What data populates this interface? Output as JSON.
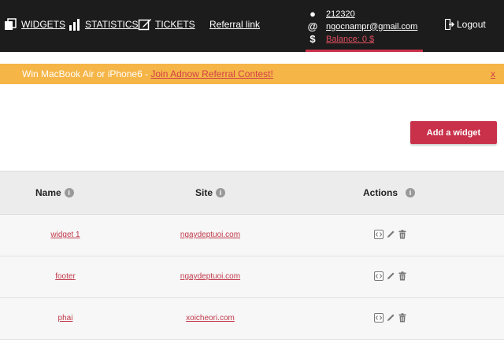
{
  "nav": {
    "widgets_label": "WIDGETS",
    "statistics_label": "STATISTICS",
    "tickets_label": "TICKETS",
    "referral_label": "Referral link"
  },
  "user": {
    "id": "212320",
    "email": "ngocnampr@gmail.com",
    "balance": "Balance: 0 $",
    "logout_label": "Logout"
  },
  "banner": {
    "text": "Win MacBook Air or iPhone6 - ",
    "link": "Join Adnow Referral Contest!",
    "close": "x"
  },
  "add_button_label": "Add a widget",
  "table": {
    "headers": {
      "name": "Name",
      "site": "Site",
      "actions": "Actions"
    },
    "rows": [
      {
        "name": "widget 1",
        "site": "ngaydeptuoi.com"
      },
      {
        "name": "footer",
        "site": "ngaydeptuoi.com"
      },
      {
        "name": "phai",
        "site": "xoicheori.com"
      }
    ]
  },
  "icons": {
    "widgets": "widgets-icon",
    "statistics": "bar-chart-icon",
    "tickets": "edit-icon",
    "user": "user-icon",
    "email": "at-icon",
    "balance": "dollar-icon",
    "logout": "logout-icon",
    "info": "info-icon",
    "code": "code-icon",
    "edit": "pencil-icon",
    "delete": "trash-icon"
  },
  "colors": {
    "topbar": "#1c1c1c",
    "accent": "#c9304a",
    "banner": "#f5b547",
    "link": "#c0394a"
  }
}
